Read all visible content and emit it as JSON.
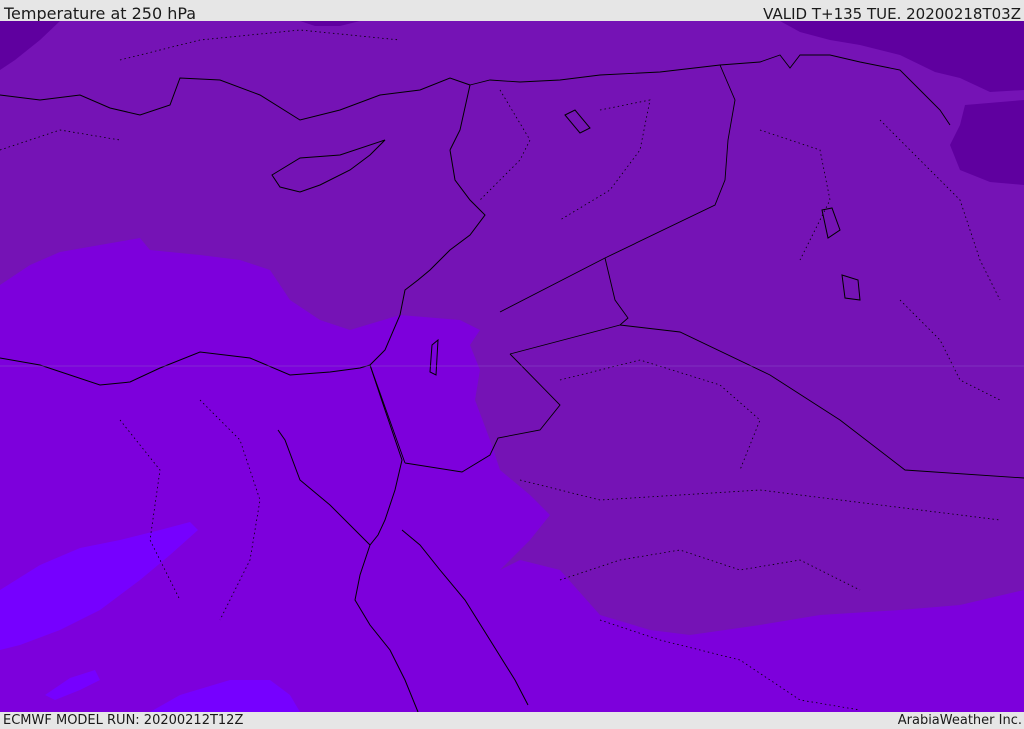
{
  "header": {
    "title": "Temperature at 250 hPa",
    "valid_time": "VALID T+135 TUE. 20200218T03Z"
  },
  "footer": {
    "model_run": "ECMWF MODEL RUN: 20200212T12Z",
    "credit": "ArabiaWeather Inc."
  },
  "map": {
    "colors": {
      "coldest": "#5f009f",
      "cold": "#7513b5",
      "mid": "#7d00dc",
      "warm": "#7600ff",
      "boundary": "#000000"
    }
  }
}
